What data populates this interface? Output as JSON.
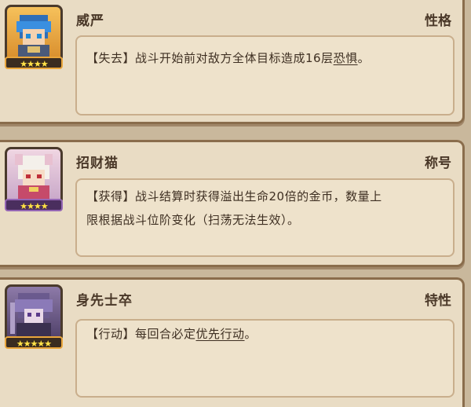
{
  "cards": [
    {
      "title": "威严",
      "tag": "性格",
      "stars": "★★★★",
      "desc_before": "【失去】战斗开始前对敌方全体目标造成16层",
      "desc_link": "恐惧",
      "desc_after": "。"
    },
    {
      "title": "招财猫",
      "tag": "称号",
      "stars": "★★★★",
      "desc_line1": "【获得】战斗结算时获得溢出生命20倍的金币，数量上",
      "desc_line2": "限根据战斗位阶变化（扫荡无法生效）。"
    },
    {
      "title": "身先士卒",
      "tag": "特性",
      "stars": "★★★★★",
      "desc_before": "【行动】每回合必定",
      "desc_link": "优先行动",
      "desc_after": "。"
    }
  ]
}
